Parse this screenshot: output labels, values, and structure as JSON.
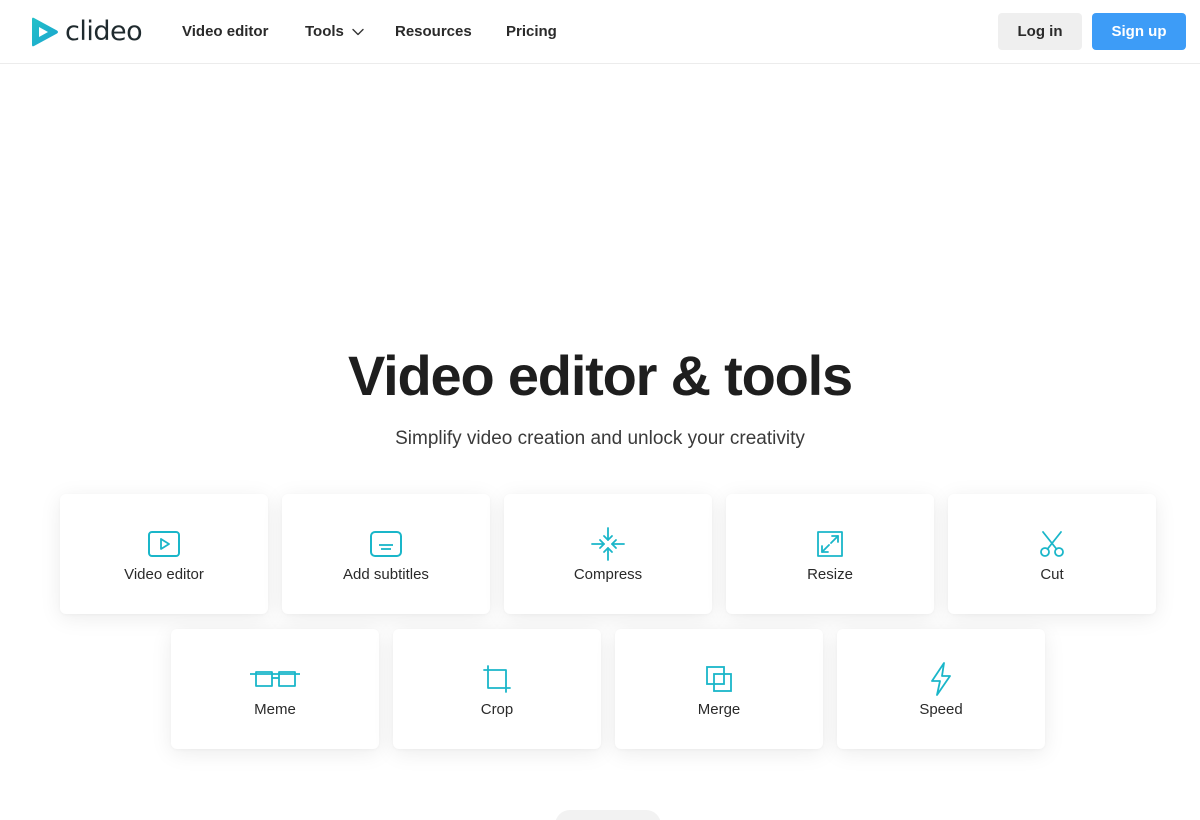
{
  "brand": {
    "name": "clideo",
    "accent": "#1ab6c9",
    "accent_secondary": "#3d9cf7"
  },
  "nav": {
    "items": [
      {
        "label": "Video editor"
      },
      {
        "label": "Tools",
        "has_dropdown": true
      },
      {
        "label": "Resources"
      },
      {
        "label": "Pricing"
      }
    ]
  },
  "auth": {
    "login_label": "Log in",
    "signup_label": "Sign up"
  },
  "hero": {
    "title": "Video editor & tools",
    "subtitle": "Simplify video creation and unlock your creativity"
  },
  "tools": [
    {
      "label": "Video editor",
      "icon": "play-square-icon"
    },
    {
      "label": "Add subtitles",
      "icon": "subtitles-icon"
    },
    {
      "label": "Compress",
      "icon": "compress-arrows-icon"
    },
    {
      "label": "Resize",
      "icon": "resize-arrows-icon"
    },
    {
      "label": "Cut",
      "icon": "scissors-icon"
    },
    {
      "label": "Meme",
      "icon": "glasses-icon"
    },
    {
      "label": "Crop",
      "icon": "crop-icon"
    },
    {
      "label": "Merge",
      "icon": "merge-squares-icon"
    },
    {
      "label": "Speed",
      "icon": "lightning-icon"
    }
  ]
}
